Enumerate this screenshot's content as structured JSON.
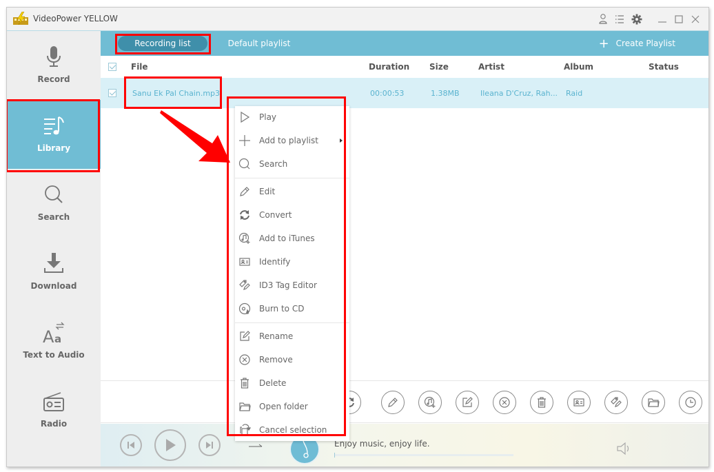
{
  "app": {
    "title": "VideoPower YELLOW",
    "title_icons": [
      "user-icon",
      "list-menu-icon",
      "gear-icon",
      "minimize-icon",
      "maximize-icon",
      "close-icon"
    ]
  },
  "sidebar": {
    "items": [
      {
        "label": "Record",
        "icon": "microphone-icon",
        "active": false
      },
      {
        "label": "Library",
        "icon": "music-library-icon",
        "active": true
      },
      {
        "label": "Search",
        "icon": "search-icon",
        "active": false
      },
      {
        "label": "Download",
        "icon": "download-icon",
        "active": false
      },
      {
        "label": "Text to Audio",
        "icon": "text-to-audio-icon",
        "active": false
      },
      {
        "label": "Radio",
        "icon": "radio-icon",
        "active": false
      }
    ]
  },
  "tabs": {
    "items": [
      {
        "label": "Recording list",
        "active": true
      },
      {
        "label": "Default playlist",
        "active": false
      }
    ],
    "create_playlist": "Create Playlist"
  },
  "table": {
    "columns": [
      "File",
      "Duration",
      "Size",
      "Artist",
      "Album",
      "Status"
    ],
    "rows": [
      {
        "checked": true,
        "file": "Sanu Ek Pal Chain.mp3",
        "duration": "00:00:53",
        "size": "1.38MB",
        "artist": "Ileana D'Cruz, Rah...",
        "album": "Raid",
        "status": ""
      }
    ]
  },
  "context_menu": {
    "items": [
      {
        "label": "Play",
        "icon": "play-icon"
      },
      {
        "label": "Add to playlist",
        "icon": "plus-icon",
        "submenu": true
      },
      {
        "label": "Search",
        "icon": "search-icon"
      },
      {
        "label": "Edit",
        "icon": "pencil-icon"
      },
      {
        "label": "Convert",
        "icon": "convert-icon"
      },
      {
        "label": "Add to iTunes",
        "icon": "itunes-add-icon"
      },
      {
        "label": "Identify",
        "icon": "identify-card-icon"
      },
      {
        "label": "ID3 Tag Editor",
        "icon": "tag-edit-icon"
      },
      {
        "label": "Burn to CD",
        "icon": "burn-cd-icon"
      },
      {
        "label": "Rename",
        "icon": "rename-icon"
      },
      {
        "label": "Remove",
        "icon": "remove-icon"
      },
      {
        "label": "Delete",
        "icon": "trash-icon"
      },
      {
        "label": "Open folder",
        "icon": "folder-icon"
      },
      {
        "label": "Cancel selection",
        "icon": "cancel-selection-icon"
      }
    ]
  },
  "toolbar": {
    "buttons": [
      "convert-icon",
      "pencil-icon",
      "itunes-add-icon",
      "rename-icon",
      "remove-icon",
      "trash-icon",
      "identify-card-icon",
      "tag-edit-icon",
      "folder-icon",
      "clock-icon"
    ]
  },
  "player": {
    "slogan": "Enjoy music, enjoy life.",
    "progress": 0
  },
  "colors": {
    "accent": "#70bdd4",
    "tab_active": "#3f8faa",
    "row_selected": "#d9f0f7",
    "row_text": "#5ab3cf",
    "highlight": "#ff0000"
  }
}
